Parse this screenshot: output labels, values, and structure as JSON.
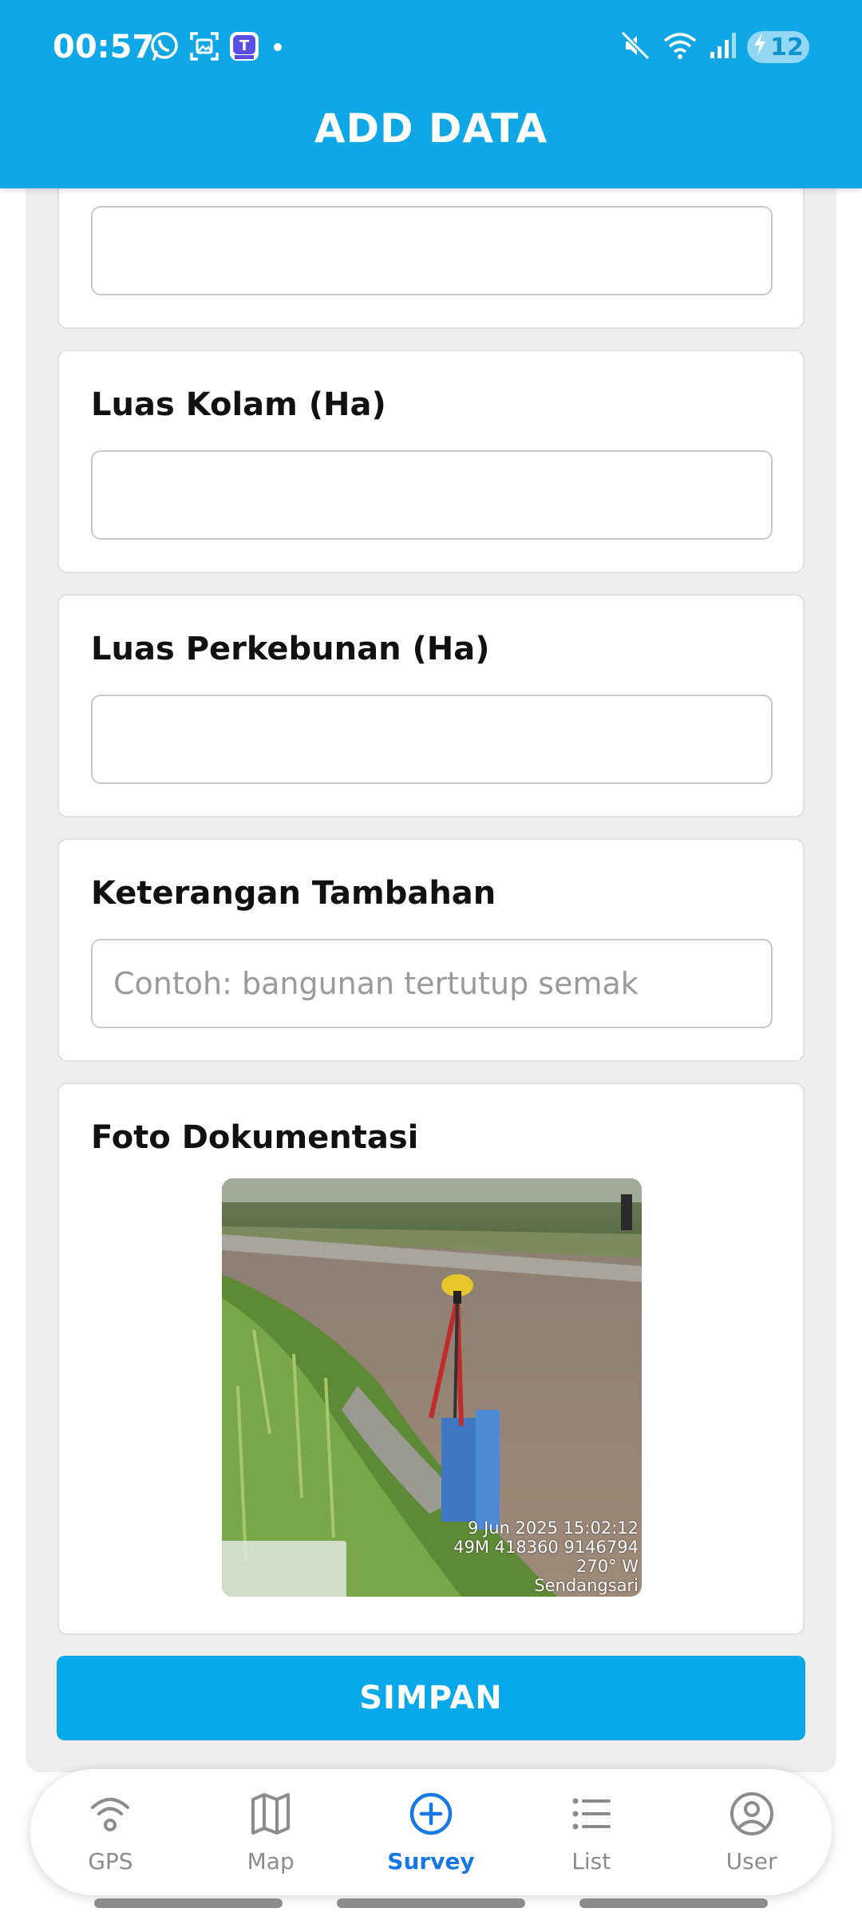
{
  "status_bar": {
    "time": "00:57",
    "battery_level": "12",
    "icons_left": [
      "whatsapp-icon",
      "screenshot-icon",
      "app-badge-icon",
      "dot-icon"
    ],
    "icons_right": [
      "mute-icon",
      "wifi-icon",
      "signal-icon",
      "battery-charging-icon"
    ]
  },
  "header": {
    "title": "ADD DATA"
  },
  "form": {
    "top_field": {
      "value": ""
    },
    "luas_kolam": {
      "label": "Luas Kolam (Ha)",
      "value": ""
    },
    "luas_perkebunan": {
      "label": "Luas Perkebunan (Ha)",
      "value": ""
    },
    "keterangan": {
      "label": "Keterangan Tambahan",
      "placeholder": "Contoh: bangunan tertutup semak",
      "value": ""
    },
    "foto": {
      "label": "Foto Dokumentasi",
      "stamp_date": "9 Jun 2025 15:02:12",
      "stamp_coords": "49M 418360 9146794",
      "stamp_bearing": "270° W",
      "stamp_place": "Sendangsari"
    },
    "save_label": "SIMPAN"
  },
  "bottom_nav": {
    "items": [
      {
        "label": "GPS",
        "icon": "gps-signal-icon",
        "active": false
      },
      {
        "label": "Map",
        "icon": "map-icon",
        "active": false
      },
      {
        "label": "Survey",
        "icon": "plus-circle-icon",
        "active": true
      },
      {
        "label": "List",
        "icon": "list-icon",
        "active": false
      },
      {
        "label": "User",
        "icon": "user-icon",
        "active": false
      }
    ]
  },
  "colors": {
    "primary": "#10a7e6",
    "button": "#07a8ea",
    "active_nav": "#1677e5",
    "nav_inactive": "#8c8c8c"
  }
}
